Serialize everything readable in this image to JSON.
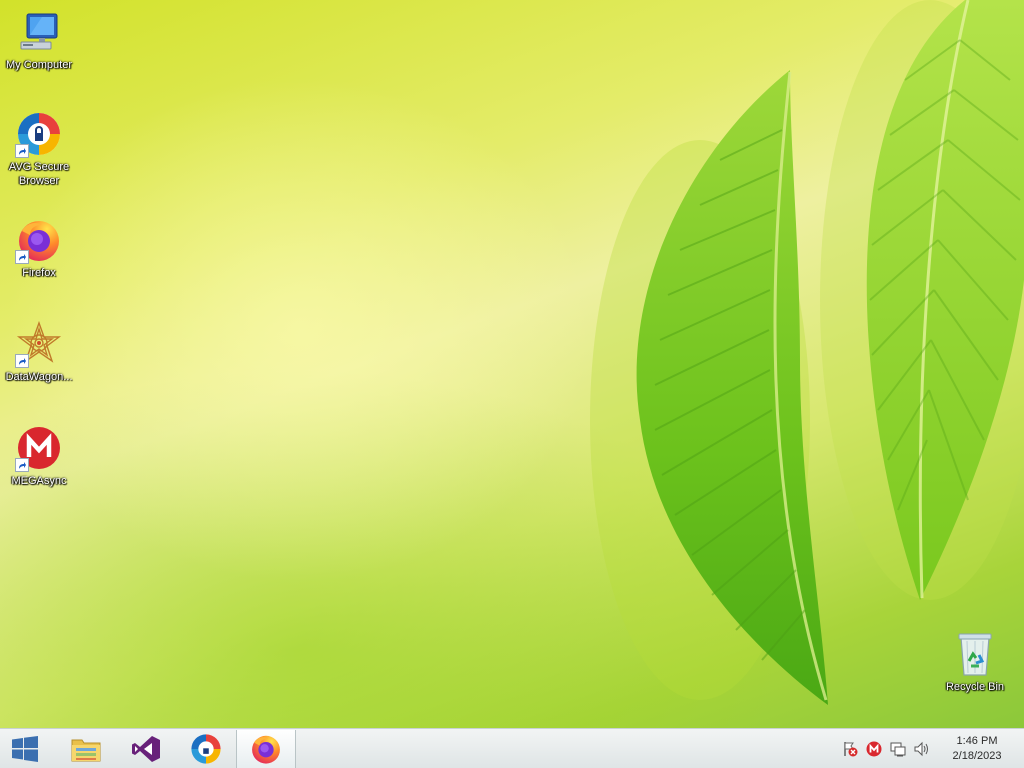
{
  "desktop": {
    "icons": [
      {
        "label": "My Computer",
        "icon": "computer-icon"
      },
      {
        "label": "AVG Secure Browser",
        "icon": "avg-browser-icon"
      },
      {
        "label": "Firefox",
        "icon": "firefox-icon"
      },
      {
        "label": "DataWagon...",
        "icon": "datawagon-icon"
      },
      {
        "label": "MEGAsync",
        "icon": "megasync-icon"
      },
      {
        "label": "Recycle Bin",
        "icon": "recycle-bin-icon"
      }
    ]
  },
  "taskbar": {
    "pinned": [
      {
        "icon": "start-icon"
      },
      {
        "icon": "file-explorer-icon"
      },
      {
        "icon": "visual-studio-icon"
      },
      {
        "icon": "avg-browser-icon"
      },
      {
        "icon": "firefox-icon",
        "active": true
      }
    ],
    "tray": [
      "action-center-flag-icon",
      "mega-tray-icon",
      "network-icon",
      "volume-icon"
    ],
    "clock": {
      "time": "1:46 PM",
      "date": "2/18/2023"
    }
  },
  "colors": {
    "wallpaper_light": "#eef0a0",
    "wallpaper_green": "#8cc83a",
    "leaf": "#6cc21c",
    "taskbar": "#e8eced",
    "mega_red": "#d9272e"
  }
}
